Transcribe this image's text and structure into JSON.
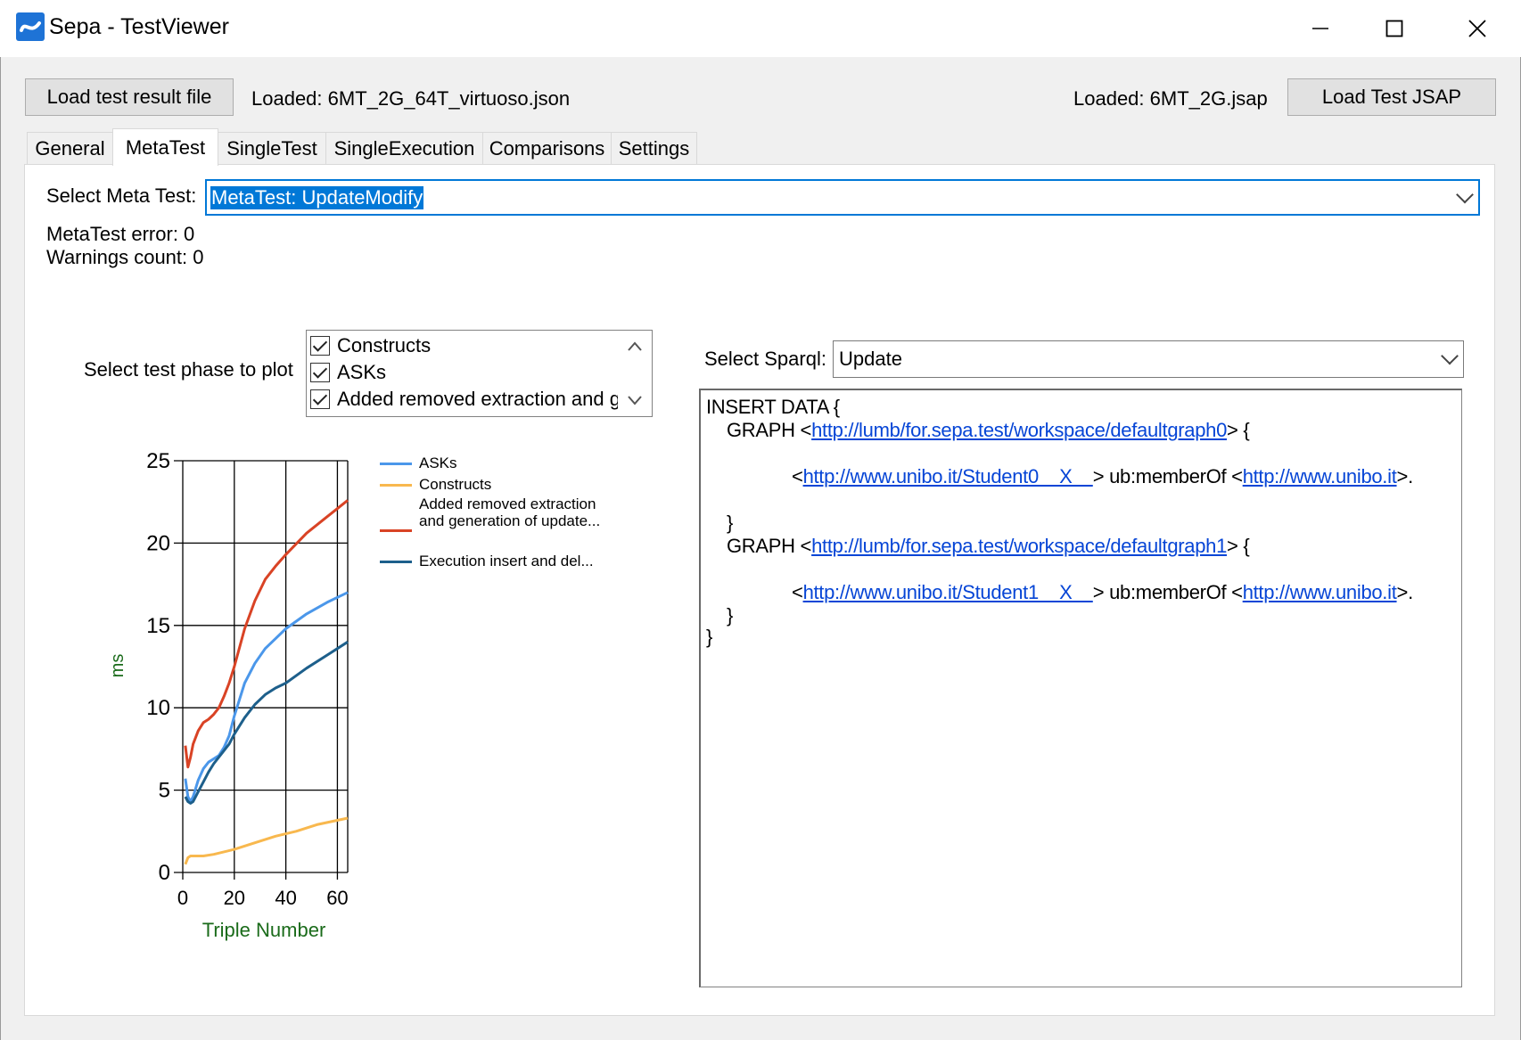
{
  "window": {
    "title": "Sepa - TestViewer"
  },
  "toolbar": {
    "load_result_label": "Load test result file",
    "loaded_result_text": "Loaded: 6MT_2G_64T_virtuoso.json",
    "loaded_jsap_text": "Loaded: 6MT_2G.jsap",
    "load_jsap_label": "Load Test JSAP"
  },
  "tabs": [
    {
      "label": "General"
    },
    {
      "label": "MetaTest"
    },
    {
      "label": "SingleTest"
    },
    {
      "label": "SingleExecution"
    },
    {
      "label": "Comparisons"
    },
    {
      "label": "Settings"
    }
  ],
  "metatest": {
    "select_label": "Select Meta Test:",
    "selected_value": "MetaTest: UpdateModify",
    "error_text": "MetaTest error: 0",
    "warnings_text": "Warnings count: 0",
    "phase_label": "Select test phase to plot",
    "phases": [
      {
        "label": "Constructs",
        "checked": true
      },
      {
        "label": "ASKs",
        "checked": true
      },
      {
        "label": "Added removed extraction and generation of update",
        "checked": true
      }
    ],
    "sparql_label": "Select Sparql:",
    "sparql_selected": "Update",
    "sparql_text": {
      "line1": "INSERT DATA {",
      "graph_kw": "GRAPH <",
      "graph0_url": "http://lumb/for.sepa.test/workspace/defaultgraph0",
      "graph1_url": "http://lumb/for.sepa.test/workspace/defaultgraph1",
      "graph_close": "> {",
      "lt": "<",
      "student0_url": "http://www.unibo.it/Student0    X    ",
      "student1_url": "http://www.unibo.it/Student1    X    ",
      "member_of": "> ub:memberOf <",
      "unibo_url": "http://www.unibo.it",
      "triple_end": ">.",
      "brace_close": "}"
    }
  },
  "chart_data": {
    "type": "line",
    "xlabel": "Triple Number",
    "ylabel": "ms",
    "xlim": [
      0,
      64
    ],
    "ylim": [
      0,
      25
    ],
    "x_ticks": [
      0,
      20,
      40,
      60
    ],
    "y_ticks": [
      0,
      5,
      10,
      15,
      20,
      25
    ],
    "grid": true,
    "legend_position": "right",
    "series": [
      {
        "name": "ASKs",
        "color": "#4b97ea",
        "x": [
          1,
          2,
          3,
          4,
          6,
          8,
          10,
          12,
          14,
          16,
          18,
          20,
          24,
          28,
          32,
          36,
          40,
          48,
          56,
          64
        ],
        "y": [
          5.7,
          4.6,
          4.3,
          4.6,
          5.6,
          6.3,
          6.7,
          6.9,
          7.1,
          7.6,
          8.3,
          9.5,
          11.5,
          12.7,
          13.6,
          14.2,
          14.8,
          15.7,
          16.4,
          17.0
        ]
      },
      {
        "name": "Constructs",
        "color": "#f8b84e",
        "x": [
          1,
          2,
          3,
          4,
          8,
          12,
          20,
          28,
          36,
          44,
          52,
          64
        ],
        "y": [
          0.5,
          0.9,
          1.0,
          1.0,
          1.0,
          1.1,
          1.4,
          1.8,
          2.2,
          2.5,
          2.9,
          3.3
        ]
      },
      {
        "name": "Added removed extraction and generation of update...",
        "color": "#d94325",
        "x": [
          1,
          2,
          3,
          4,
          6,
          8,
          10,
          12,
          14,
          16,
          18,
          20,
          24,
          28,
          32,
          36,
          40,
          48,
          56,
          64
        ],
        "y": [
          7.7,
          6.4,
          7.0,
          7.8,
          8.6,
          9.1,
          9.3,
          9.6,
          10.0,
          10.7,
          11.5,
          12.5,
          14.8,
          16.5,
          17.8,
          18.6,
          19.3,
          20.6,
          21.6,
          22.6
        ]
      },
      {
        "name": "Execution insert and del...",
        "color": "#1d5f8b",
        "x": [
          1,
          2,
          3,
          4,
          6,
          8,
          10,
          12,
          14,
          16,
          18,
          20,
          24,
          28,
          32,
          36,
          40,
          48,
          56,
          64
        ],
        "y": [
          4.6,
          4.3,
          4.2,
          4.3,
          4.9,
          5.5,
          6.1,
          6.6,
          7.0,
          7.4,
          7.8,
          8.4,
          9.4,
          10.2,
          10.8,
          11.2,
          11.5,
          12.4,
          13.2,
          14.0
        ]
      }
    ]
  }
}
